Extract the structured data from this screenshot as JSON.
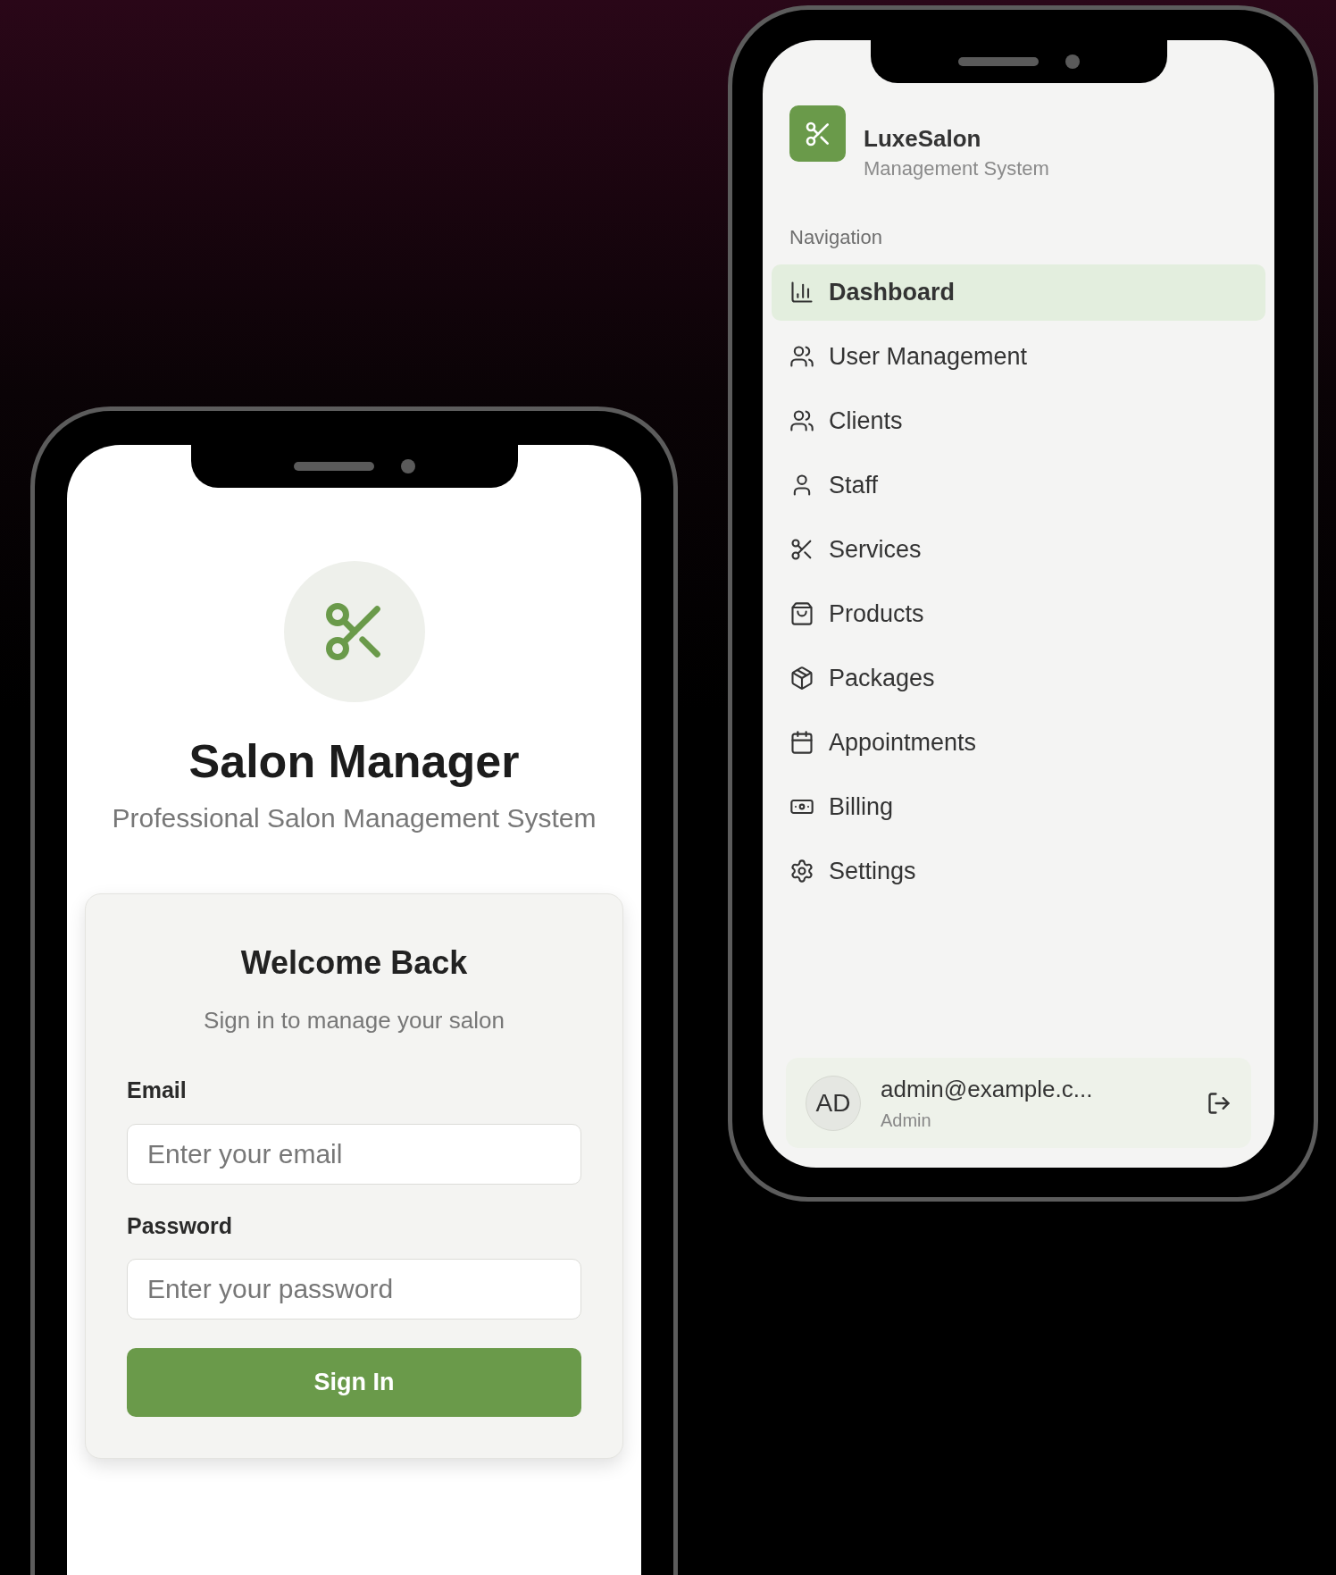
{
  "login": {
    "app_title": "Salon Manager",
    "app_subtitle": "Professional Salon Management System",
    "card": {
      "title": "Welcome Back",
      "subtitle": "Sign in to manage your salon",
      "fields": [
        {
          "label": "Email",
          "placeholder": "Enter your email"
        },
        {
          "label": "Password",
          "placeholder": "Enter your password"
        }
      ],
      "button": "Sign In"
    }
  },
  "sidebar": {
    "brand": {
      "name": "LuxeSalon",
      "tagline": "Management System"
    },
    "section_label": "Navigation",
    "items": [
      {
        "label": "Dashboard",
        "selected": true
      },
      {
        "label": "User Management",
        "selected": false
      },
      {
        "label": "Clients",
        "selected": false
      },
      {
        "label": "Staff",
        "selected": false
      },
      {
        "label": "Services",
        "selected": false
      },
      {
        "label": "Products",
        "selected": false
      },
      {
        "label": "Packages",
        "selected": false
      },
      {
        "label": "Appointments",
        "selected": false
      },
      {
        "label": "Billing",
        "selected": false
      },
      {
        "label": "Settings",
        "selected": false
      }
    ],
    "user": {
      "initials": "AD",
      "email": "admin@example.c...",
      "role": "Admin"
    }
  }
}
